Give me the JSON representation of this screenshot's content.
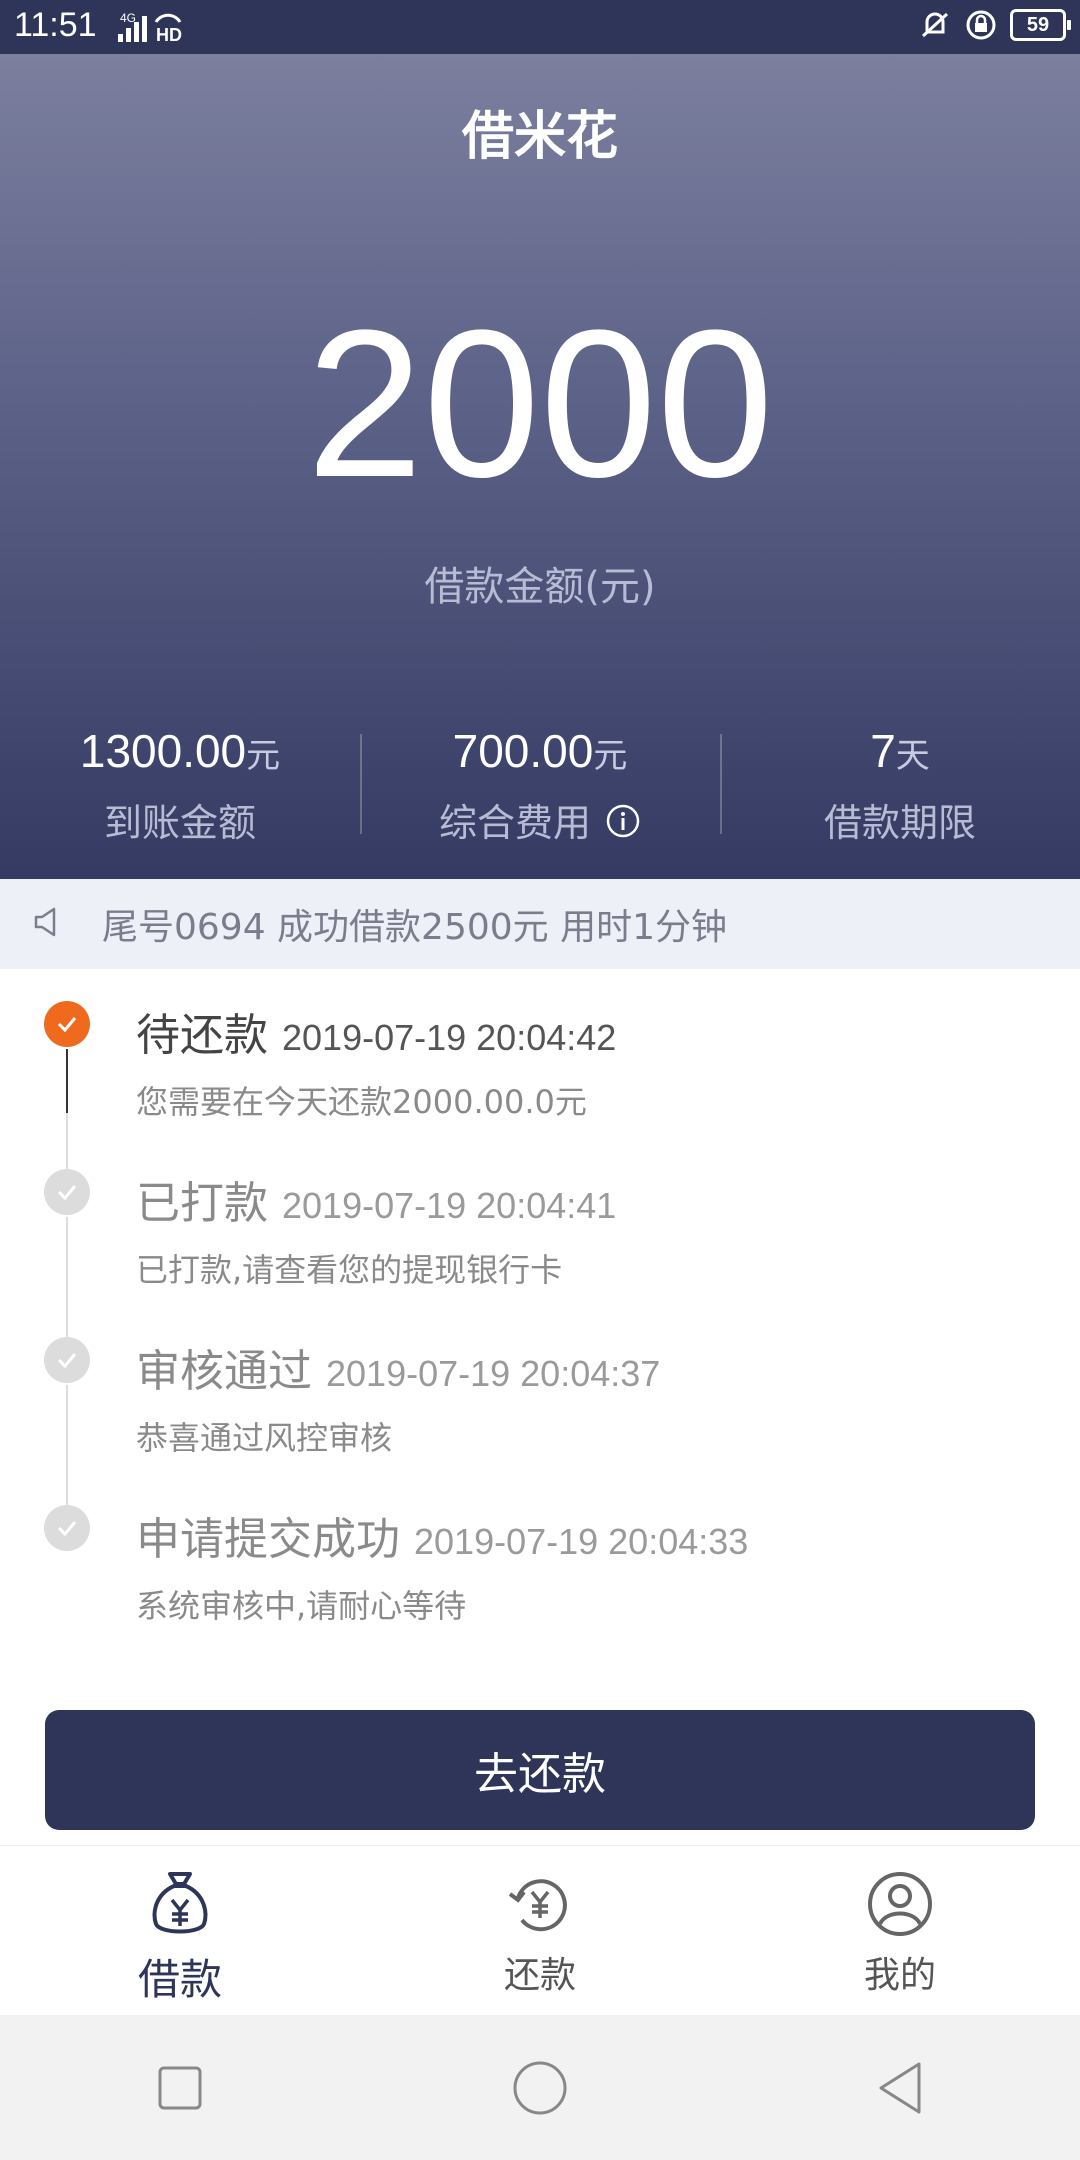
{
  "status_bar": {
    "time": "11:51",
    "network": "4G",
    "hd": "HD",
    "battery": "59"
  },
  "app": {
    "title": "借米花"
  },
  "hero": {
    "amount": "2000",
    "amount_label": "借款金额(元)",
    "stats": [
      {
        "value": "1300.00",
        "unit": "元",
        "label": "到账金额"
      },
      {
        "value": "700.00",
        "unit": "元",
        "label": "综合费用"
      },
      {
        "value": "7",
        "unit": "天",
        "label": "借款期限"
      }
    ]
  },
  "notice": {
    "text": "尾号0694 成功借款2500元 用时1分钟"
  },
  "timeline": [
    {
      "status": "待还款",
      "time": "2019-07-19 20:04:42",
      "desc": "您需要在今天还款2000.00.0元",
      "state": "active"
    },
    {
      "status": "已打款",
      "time": "2019-07-19 20:04:41",
      "desc": "已打款,请查看您的提现银行卡",
      "state": "done"
    },
    {
      "status": "审核通过",
      "time": "2019-07-19 20:04:37",
      "desc": "恭喜通过风控审核",
      "state": "done"
    },
    {
      "status": "申请提交成功",
      "time": "2019-07-19 20:04:33",
      "desc": "系统审核中,请耐心等待",
      "state": "done"
    }
  ],
  "primary_button": {
    "label": "去还款"
  },
  "tabbar": {
    "active_color": "#2e3558",
    "items": [
      {
        "label": "借款",
        "icon": "money-bag-icon",
        "active": true
      },
      {
        "label": "还款",
        "icon": "repay-cycle-icon",
        "active": false
      },
      {
        "label": "我的",
        "icon": "user-profile-icon",
        "active": false
      }
    ]
  },
  "colors": {
    "brand": "#2e3558",
    "accent": "#f06a1e"
  }
}
